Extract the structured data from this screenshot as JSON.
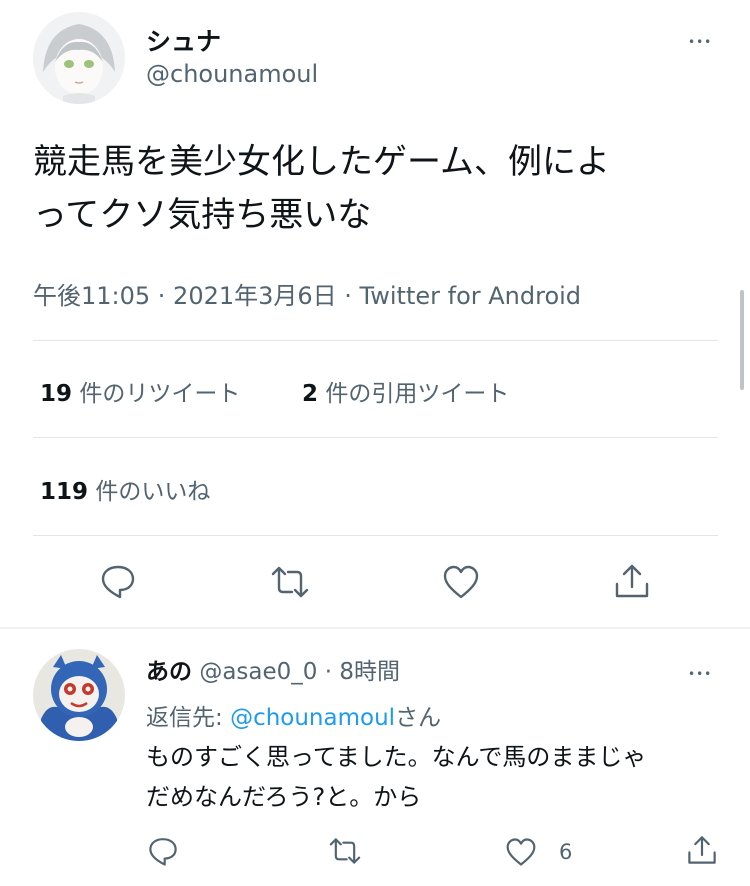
{
  "tweet": {
    "display_name": "シュナ",
    "handle": "@chounamoul",
    "text_line1": "競走馬を美少女化したゲーム、例によ",
    "text_line2": "ってクソ気持ち悪いな",
    "meta": "午後11:05 · 2021年3月6日 · Twitter for Android",
    "more_label": "•••"
  },
  "stats": {
    "retweets_count": "19",
    "retweets_label": "件のリツイート",
    "quotes_count": "2",
    "quotes_label": "件の引用ツイート",
    "likes_count": "119",
    "likes_label": "件のいいね"
  },
  "actions": {
    "icons": [
      "reply-icon",
      "retweet-icon",
      "like-icon",
      "share-icon"
    ]
  },
  "reply": {
    "display_name": "あの",
    "handle": "@asae0_0",
    "separator": "·",
    "time": "8時間",
    "replying_prefix": "返信先:",
    "replying_handle": "@chounamoul",
    "replying_suffix": "さん",
    "text_line1": "ものすごく思ってました。なんで馬のままじゃ",
    "text_line2": "だめなんだろう?と。から",
    "like_count": "6",
    "more_label": "•••"
  },
  "colors": {
    "text": "#0f1419",
    "secondary": "#536471",
    "link": "#1d9bf0",
    "divider": "#e1e6ea"
  }
}
